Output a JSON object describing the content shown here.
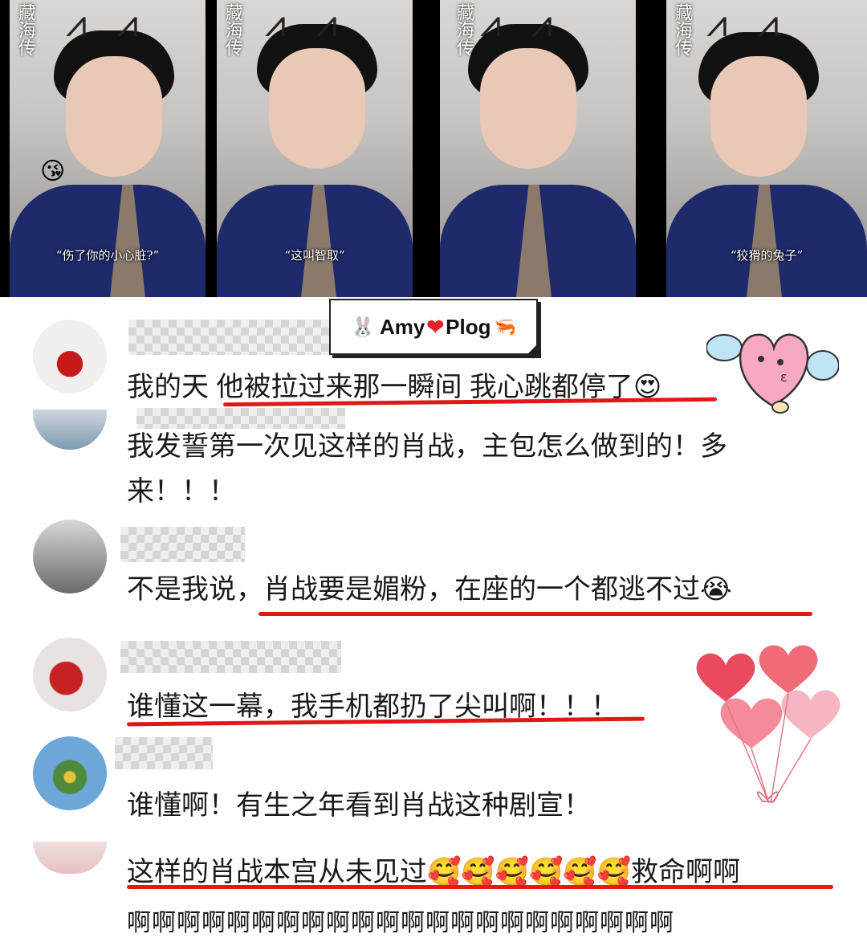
{
  "video_strip": {
    "panels": [
      {
        "caption": "“伤了你的小心脏?”",
        "logo_text": "藏海传"
      },
      {
        "caption": "“这叫智取”",
        "logo_text": "藏海传"
      },
      {
        "caption": "",
        "logo_text": "藏海传"
      },
      {
        "caption": "“狡猾的兔子”",
        "logo_text": "藏海传"
      }
    ]
  },
  "badge": {
    "text": "Amy",
    "heart": "❤",
    "text2": "Plog",
    "rabbit_icon": "rabbit-face",
    "shrimp_icon": "shrimp"
  },
  "comments": [
    {
      "text": "我的天 他被拉过来那一瞬间 我心跳都停了",
      "emoji": "😍",
      "underlined": true
    },
    {
      "text_line1": "我发誓第一次见这样的肖战，主包怎么做到的！多",
      "text_line2": "来！！！",
      "underlined": false
    },
    {
      "text": "不是我说，肖战要是媚粉，在座的一个都逃不过",
      "emoji": "😭",
      "underlined": true
    },
    {
      "text": "谁懂这一幕，我手机都扔了尖叫啊！！！",
      "underlined": true
    },
    {
      "text": "谁懂啊！有生之年看到肖战这种剧宣！",
      "underlined": false
    },
    {
      "text_before": "这样的肖战本宫从未见过",
      "emojis": "🥰🥰🥰🥰🥰🥰",
      "text_after": "救命啊啊",
      "line2": "啊啊啊啊啊啊啊啊啊啊啊啊啊啊啊啊啊啊啊啊啊啊",
      "underlined": true
    }
  ],
  "colors": {
    "underline": "#e01818",
    "shirt": "#1f2a6b",
    "background": "#ffffff"
  }
}
